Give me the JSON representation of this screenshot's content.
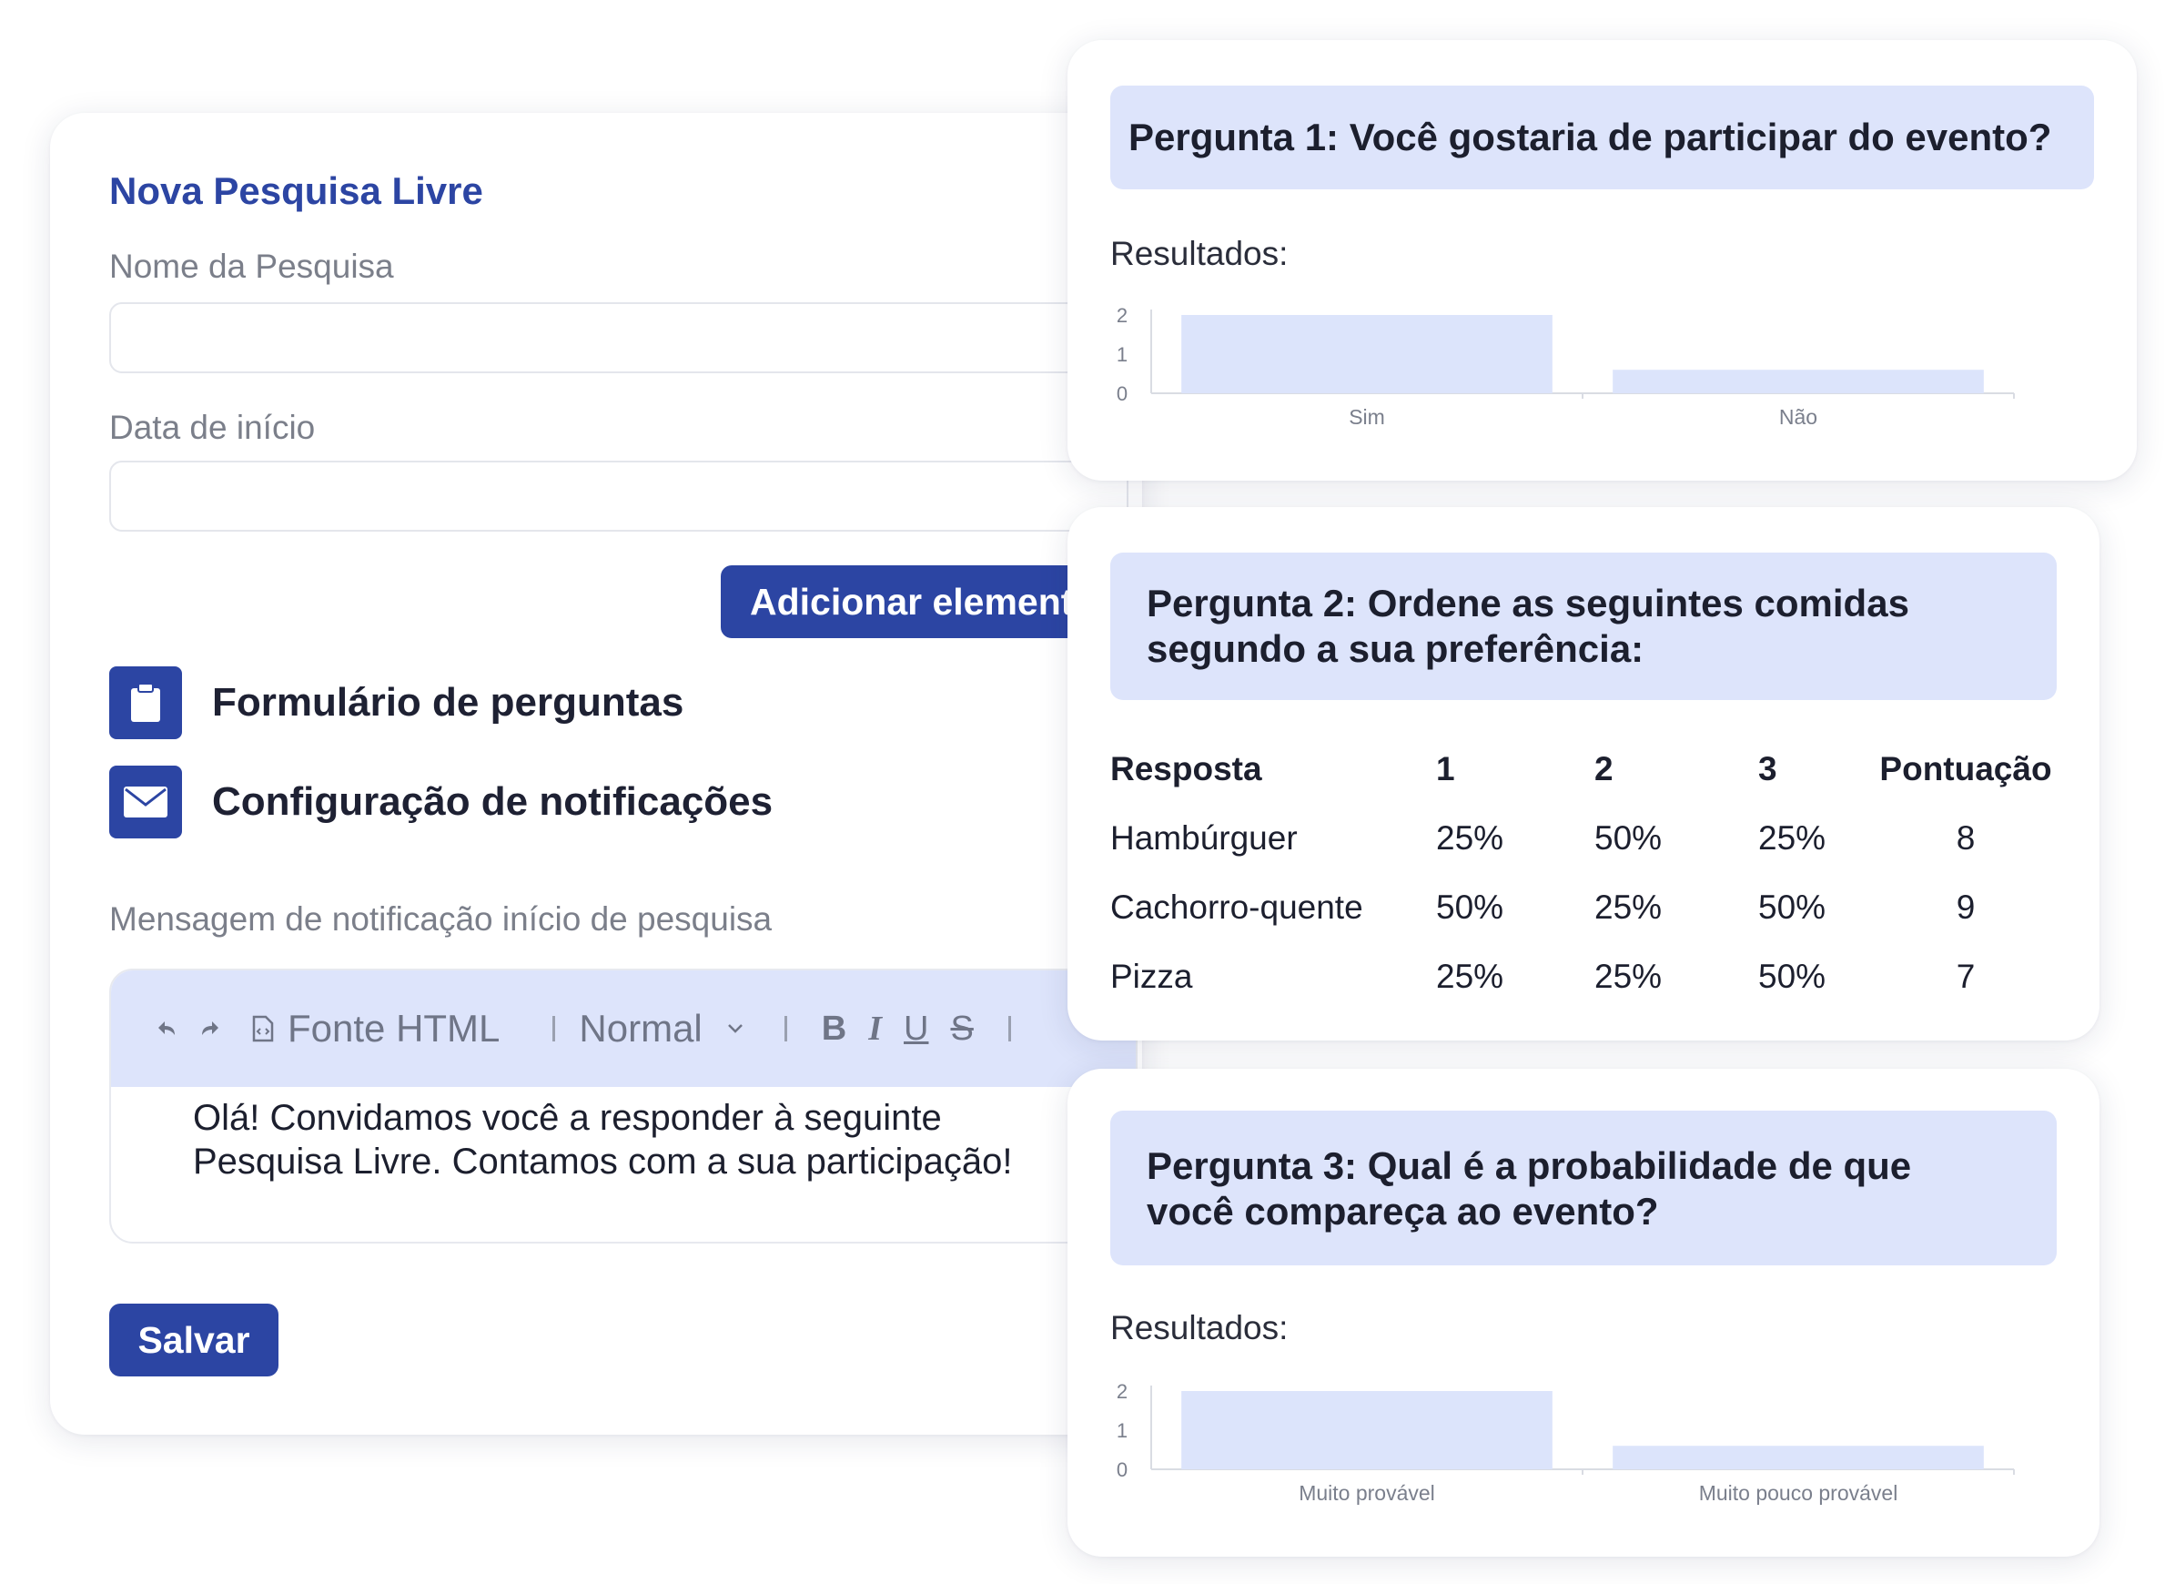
{
  "form": {
    "title": "Nova Pesquisa Livre",
    "name_label": "Nome da Pesquisa",
    "name_value": "",
    "date_label": "Data de início",
    "date_value": "",
    "add_button": "Adicionar elemento",
    "sections": [
      {
        "label": "Formulário de perguntas",
        "icon": "clipboard-icon"
      },
      {
        "label": "Configuração de notificações",
        "icon": "envelope-icon"
      }
    ],
    "message_label": "Mensagem de notificação início de pesquisa",
    "editor": {
      "source_label": "Fonte HTML",
      "format_value": "Normal",
      "bold": "B",
      "italic": "I",
      "underline": "U",
      "strike": "S",
      "text_line1": "Olá! Convidamos você a responder à seguinte",
      "text_line2": "Pesquisa Livre. Contamos com a sua participação!"
    },
    "save_button": "Salvar"
  },
  "q1": {
    "title": "Pergunta 1: Você gostaria de participar do evento?",
    "results_label": "Resultados:"
  },
  "q2": {
    "title_line1": "Pergunta 2: Ordene as seguintes comidas",
    "title_line2": "segundo a sua preferência:",
    "columns": [
      "Resposta",
      "1",
      "2",
      "3",
      "Pontuação"
    ],
    "rows": [
      [
        "Hambúrguer",
        "25%",
        "50%",
        "25%",
        "8"
      ],
      [
        "Cachorro-quente",
        "50%",
        "25%",
        "50%",
        "9"
      ],
      [
        "Pizza",
        "25%",
        "25%",
        "50%",
        "7"
      ]
    ]
  },
  "q3": {
    "title_line1": "Pergunta 3: Qual é a probabilidade de que",
    "title_line2": "você compareça ao evento?",
    "results_label": "Resultados:"
  },
  "colors": {
    "accent": "#2c45a3",
    "header_bg": "#dde4fb",
    "bar": "#dce4fb"
  },
  "chart_data": [
    {
      "type": "bar",
      "categories": [
        "Sim",
        "Não"
      ],
      "values": [
        2,
        0.6
      ],
      "ylim": [
        0,
        2
      ],
      "yticks": [
        "0",
        "1",
        "2"
      ]
    },
    {
      "type": "bar",
      "categories": [
        "Muito provável",
        "Muito pouco provável"
      ],
      "values": [
        2,
        0.6
      ],
      "ylim": [
        0,
        2
      ],
      "yticks": [
        "0",
        "1",
        "2"
      ]
    }
  ]
}
